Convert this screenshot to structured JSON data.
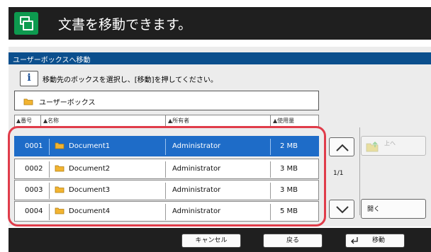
{
  "banner": {
    "title": "文書を移動できます。",
    "icon": "move-documents-icon",
    "color": "#0d9a4f"
  },
  "panel": {
    "title": "ユーザーボックスへ移動",
    "info_icon": "i",
    "info_text": "移動先のボックスを選択し、[移動]を押してください。",
    "breadcrumb": "ユーザーボックス"
  },
  "table": {
    "headers": [
      "番号",
      "名称",
      "所有者",
      "使用量"
    ],
    "rows": [
      {
        "number": "0001",
        "name": "Document1",
        "owner": "Administrator",
        "usage": "2  MB",
        "selected": true
      },
      {
        "number": "0002",
        "name": "Document2",
        "owner": "Administrator",
        "usage": "3  MB",
        "selected": false
      },
      {
        "number": "0003",
        "name": "Document3",
        "owner": "Administrator",
        "usage": "3  MB",
        "selected": false
      },
      {
        "number": "0004",
        "name": "Document4",
        "owner": "Administrator",
        "usage": "5  MB",
        "selected": false
      }
    ]
  },
  "pagination": {
    "indicator": "1/1"
  },
  "side": {
    "up_label": "上へ",
    "open_label": "開く"
  },
  "footer": {
    "cancel": "キャンセル",
    "back": "戻る",
    "move": "移動"
  },
  "colors": {
    "selected_row": "#1e6cc8",
    "title_bar": "#0b4f8d",
    "highlight": "#e03c4a",
    "folder": "#f2b431"
  }
}
